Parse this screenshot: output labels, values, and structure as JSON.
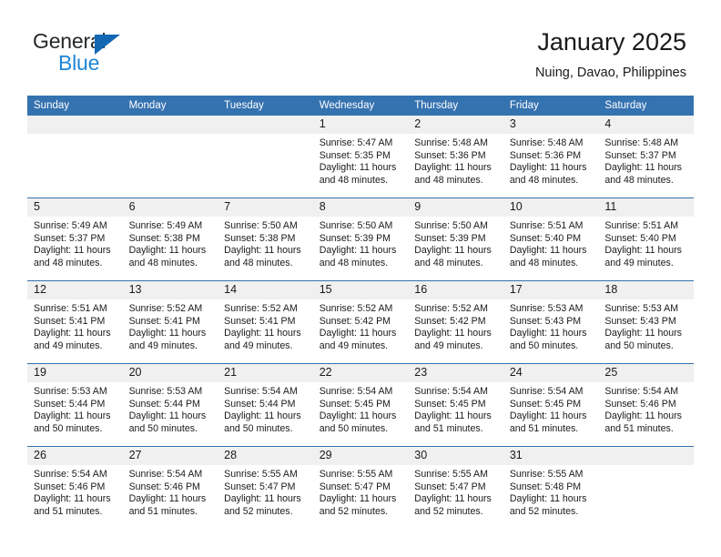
{
  "brand": {
    "name_top": "General",
    "name_bottom": "Blue",
    "triangle_color": "#1268b3",
    "bottom_color": "#1e86d6"
  },
  "header": {
    "title": "January 2025",
    "subtitle": "Nuing, Davao, Philippines"
  },
  "theme": {
    "header_bg": "#3572b0",
    "header_text": "#ffffff",
    "daynum_bg": "#f0f0f0",
    "grid_line": "#3572b0",
    "text": "#1a1a1a"
  },
  "calendar": {
    "weekday_headers": [
      "Sunday",
      "Monday",
      "Tuesday",
      "Wednesday",
      "Thursday",
      "Friday",
      "Saturday"
    ],
    "weeks": [
      [
        {
          "day": "",
          "sunrise": "",
          "sunset": "",
          "daylight_line1": "",
          "daylight_line2": ""
        },
        {
          "day": "",
          "sunrise": "",
          "sunset": "",
          "daylight_line1": "",
          "daylight_line2": ""
        },
        {
          "day": "",
          "sunrise": "",
          "sunset": "",
          "daylight_line1": "",
          "daylight_line2": ""
        },
        {
          "day": "1",
          "sunrise": "Sunrise: 5:47 AM",
          "sunset": "Sunset: 5:35 PM",
          "daylight_line1": "Daylight: 11 hours",
          "daylight_line2": "and 48 minutes."
        },
        {
          "day": "2",
          "sunrise": "Sunrise: 5:48 AM",
          "sunset": "Sunset: 5:36 PM",
          "daylight_line1": "Daylight: 11 hours",
          "daylight_line2": "and 48 minutes."
        },
        {
          "day": "3",
          "sunrise": "Sunrise: 5:48 AM",
          "sunset": "Sunset: 5:36 PM",
          "daylight_line1": "Daylight: 11 hours",
          "daylight_line2": "and 48 minutes."
        },
        {
          "day": "4",
          "sunrise": "Sunrise: 5:48 AM",
          "sunset": "Sunset: 5:37 PM",
          "daylight_line1": "Daylight: 11 hours",
          "daylight_line2": "and 48 minutes."
        }
      ],
      [
        {
          "day": "5",
          "sunrise": "Sunrise: 5:49 AM",
          "sunset": "Sunset: 5:37 PM",
          "daylight_line1": "Daylight: 11 hours",
          "daylight_line2": "and 48 minutes."
        },
        {
          "day": "6",
          "sunrise": "Sunrise: 5:49 AM",
          "sunset": "Sunset: 5:38 PM",
          "daylight_line1": "Daylight: 11 hours",
          "daylight_line2": "and 48 minutes."
        },
        {
          "day": "7",
          "sunrise": "Sunrise: 5:50 AM",
          "sunset": "Sunset: 5:38 PM",
          "daylight_line1": "Daylight: 11 hours",
          "daylight_line2": "and 48 minutes."
        },
        {
          "day": "8",
          "sunrise": "Sunrise: 5:50 AM",
          "sunset": "Sunset: 5:39 PM",
          "daylight_line1": "Daylight: 11 hours",
          "daylight_line2": "and 48 minutes."
        },
        {
          "day": "9",
          "sunrise": "Sunrise: 5:50 AM",
          "sunset": "Sunset: 5:39 PM",
          "daylight_line1": "Daylight: 11 hours",
          "daylight_line2": "and 48 minutes."
        },
        {
          "day": "10",
          "sunrise": "Sunrise: 5:51 AM",
          "sunset": "Sunset: 5:40 PM",
          "daylight_line1": "Daylight: 11 hours",
          "daylight_line2": "and 48 minutes."
        },
        {
          "day": "11",
          "sunrise": "Sunrise: 5:51 AM",
          "sunset": "Sunset: 5:40 PM",
          "daylight_line1": "Daylight: 11 hours",
          "daylight_line2": "and 49 minutes."
        }
      ],
      [
        {
          "day": "12",
          "sunrise": "Sunrise: 5:51 AM",
          "sunset": "Sunset: 5:41 PM",
          "daylight_line1": "Daylight: 11 hours",
          "daylight_line2": "and 49 minutes."
        },
        {
          "day": "13",
          "sunrise": "Sunrise: 5:52 AM",
          "sunset": "Sunset: 5:41 PM",
          "daylight_line1": "Daylight: 11 hours",
          "daylight_line2": "and 49 minutes."
        },
        {
          "day": "14",
          "sunrise": "Sunrise: 5:52 AM",
          "sunset": "Sunset: 5:41 PM",
          "daylight_line1": "Daylight: 11 hours",
          "daylight_line2": "and 49 minutes."
        },
        {
          "day": "15",
          "sunrise": "Sunrise: 5:52 AM",
          "sunset": "Sunset: 5:42 PM",
          "daylight_line1": "Daylight: 11 hours",
          "daylight_line2": "and 49 minutes."
        },
        {
          "day": "16",
          "sunrise": "Sunrise: 5:52 AM",
          "sunset": "Sunset: 5:42 PM",
          "daylight_line1": "Daylight: 11 hours",
          "daylight_line2": "and 49 minutes."
        },
        {
          "day": "17",
          "sunrise": "Sunrise: 5:53 AM",
          "sunset": "Sunset: 5:43 PM",
          "daylight_line1": "Daylight: 11 hours",
          "daylight_line2": "and 50 minutes."
        },
        {
          "day": "18",
          "sunrise": "Sunrise: 5:53 AM",
          "sunset": "Sunset: 5:43 PM",
          "daylight_line1": "Daylight: 11 hours",
          "daylight_line2": "and 50 minutes."
        }
      ],
      [
        {
          "day": "19",
          "sunrise": "Sunrise: 5:53 AM",
          "sunset": "Sunset: 5:44 PM",
          "daylight_line1": "Daylight: 11 hours",
          "daylight_line2": "and 50 minutes."
        },
        {
          "day": "20",
          "sunrise": "Sunrise: 5:53 AM",
          "sunset": "Sunset: 5:44 PM",
          "daylight_line1": "Daylight: 11 hours",
          "daylight_line2": "and 50 minutes."
        },
        {
          "day": "21",
          "sunrise": "Sunrise: 5:54 AM",
          "sunset": "Sunset: 5:44 PM",
          "daylight_line1": "Daylight: 11 hours",
          "daylight_line2": "and 50 minutes."
        },
        {
          "day": "22",
          "sunrise": "Sunrise: 5:54 AM",
          "sunset": "Sunset: 5:45 PM",
          "daylight_line1": "Daylight: 11 hours",
          "daylight_line2": "and 50 minutes."
        },
        {
          "day": "23",
          "sunrise": "Sunrise: 5:54 AM",
          "sunset": "Sunset: 5:45 PM",
          "daylight_line1": "Daylight: 11 hours",
          "daylight_line2": "and 51 minutes."
        },
        {
          "day": "24",
          "sunrise": "Sunrise: 5:54 AM",
          "sunset": "Sunset: 5:45 PM",
          "daylight_line1": "Daylight: 11 hours",
          "daylight_line2": "and 51 minutes."
        },
        {
          "day": "25",
          "sunrise": "Sunrise: 5:54 AM",
          "sunset": "Sunset: 5:46 PM",
          "daylight_line1": "Daylight: 11 hours",
          "daylight_line2": "and 51 minutes."
        }
      ],
      [
        {
          "day": "26",
          "sunrise": "Sunrise: 5:54 AM",
          "sunset": "Sunset: 5:46 PM",
          "daylight_line1": "Daylight: 11 hours",
          "daylight_line2": "and 51 minutes."
        },
        {
          "day": "27",
          "sunrise": "Sunrise: 5:54 AM",
          "sunset": "Sunset: 5:46 PM",
          "daylight_line1": "Daylight: 11 hours",
          "daylight_line2": "and 51 minutes."
        },
        {
          "day": "28",
          "sunrise": "Sunrise: 5:55 AM",
          "sunset": "Sunset: 5:47 PM",
          "daylight_line1": "Daylight: 11 hours",
          "daylight_line2": "and 52 minutes."
        },
        {
          "day": "29",
          "sunrise": "Sunrise: 5:55 AM",
          "sunset": "Sunset: 5:47 PM",
          "daylight_line1": "Daylight: 11 hours",
          "daylight_line2": "and 52 minutes."
        },
        {
          "day": "30",
          "sunrise": "Sunrise: 5:55 AM",
          "sunset": "Sunset: 5:47 PM",
          "daylight_line1": "Daylight: 11 hours",
          "daylight_line2": "and 52 minutes."
        },
        {
          "day": "31",
          "sunrise": "Sunrise: 5:55 AM",
          "sunset": "Sunset: 5:48 PM",
          "daylight_line1": "Daylight: 11 hours",
          "daylight_line2": "and 52 minutes."
        },
        {
          "day": "",
          "sunrise": "",
          "sunset": "",
          "daylight_line1": "",
          "daylight_line2": ""
        }
      ]
    ]
  }
}
